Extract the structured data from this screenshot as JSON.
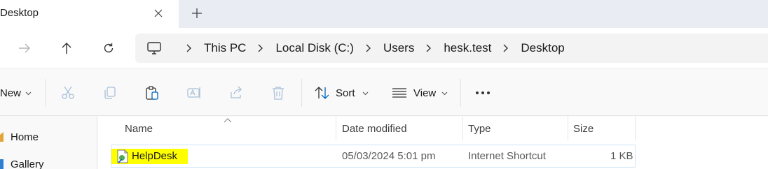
{
  "tab": {
    "title": "Desktop"
  },
  "breadcrumb": [
    "This PC",
    "Local Disk (C:)",
    "Users",
    "hesk.test",
    "Desktop"
  ],
  "commandbar": {
    "new_label": "New",
    "sort_label": "Sort",
    "view_label": "View"
  },
  "navpane": {
    "items": [
      {
        "label": "Home",
        "icon": "home-icon"
      },
      {
        "label": "Gallery",
        "icon": "gallery-icon"
      }
    ]
  },
  "columns": {
    "name": "Name",
    "date": "Date modified",
    "type": "Type",
    "size": "Size"
  },
  "files": [
    {
      "name": "HelpDesk",
      "date": "05/03/2024 5:01 pm",
      "type": "Internet Shortcut",
      "size": "1 KB",
      "highlighted": true
    }
  ],
  "colors": {
    "accent_blue": "#0067c0",
    "highlight": "#ffff00",
    "selection_border": "#cfe4f7"
  }
}
